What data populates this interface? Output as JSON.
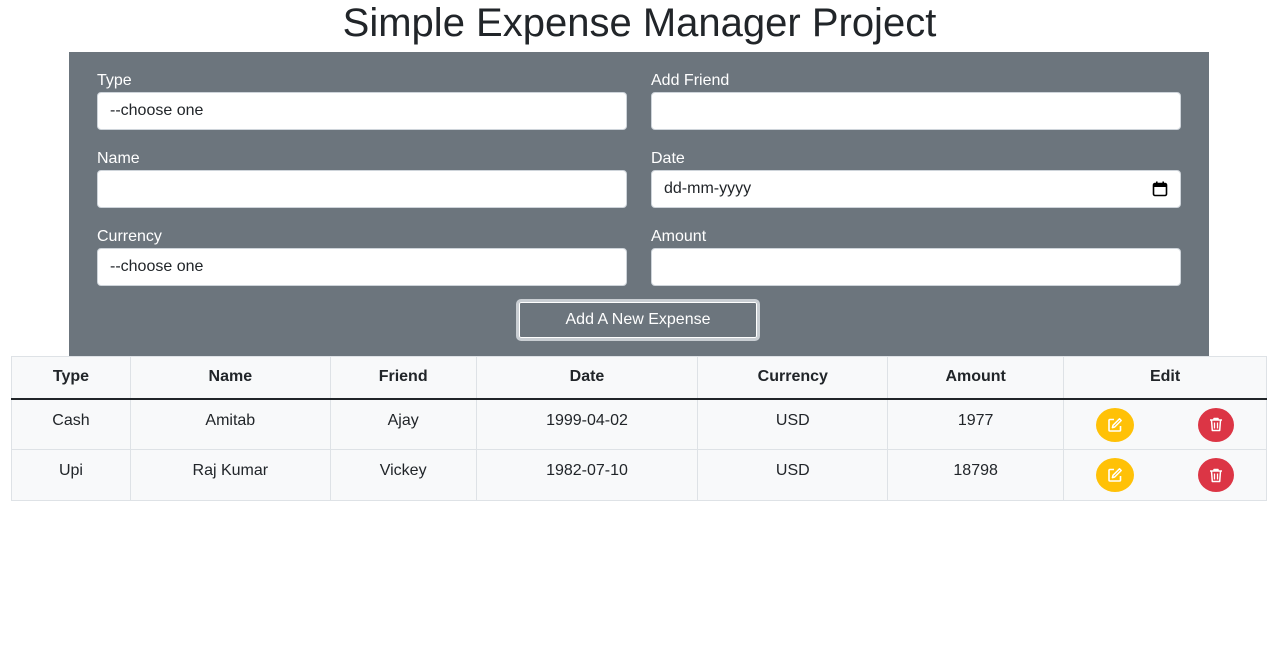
{
  "page": {
    "title": "Simple Expense Manager Project"
  },
  "form": {
    "type_label": "Type",
    "type_value": "--choose one",
    "friend_label": "Add Friend",
    "friend_value": "",
    "name_label": "Name",
    "name_value": "",
    "date_label": "Date",
    "date_value": "dd-mm-yyyy",
    "currency_label": "Currency",
    "currency_value": "--choose one",
    "amount_label": "Amount",
    "amount_value": "",
    "submit_label": "Add A New Expense"
  },
  "table": {
    "headers": [
      "Type",
      "Name",
      "Friend",
      "Date",
      "Currency",
      "Amount",
      "Edit"
    ],
    "rows": [
      {
        "type": "Cash",
        "name": "Amitab",
        "friend": "Ajay",
        "date": "1999-04-02",
        "currency": "USD",
        "amount": "1977"
      },
      {
        "type": "Upi",
        "name": "Raj Kumar",
        "friend": "Vickey",
        "date": "1982-07-10",
        "currency": "USD",
        "amount": "18798"
      }
    ]
  },
  "colors": {
    "panel": "#6c757d",
    "edit_button": "#ffc107",
    "delete_button": "#dc3545"
  },
  "icons": {
    "date": "calendar-icon",
    "edit": "edit-icon",
    "delete": "trash-icon"
  }
}
